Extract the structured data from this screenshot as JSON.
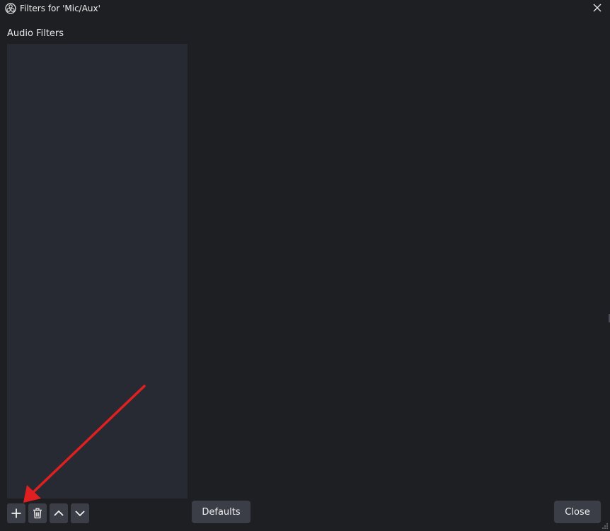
{
  "window": {
    "title": "Filters for 'Mic/Aux'",
    "app_icon": "obs-logo-icon",
    "close_icon": "close-icon"
  },
  "filters": {
    "section_label": "Audio Filters",
    "items": []
  },
  "toolbar": {
    "add_icon": "plus-icon",
    "remove_icon": "trash-icon",
    "move_up_icon": "chevron-up-icon",
    "move_down_icon": "chevron-down-icon"
  },
  "buttons": {
    "defaults_label": "Defaults",
    "close_label": "Close"
  },
  "annotation": {
    "arrow_color": "#e02020",
    "points_to": "add-filter-button"
  },
  "colors": {
    "background": "#1e1f22",
    "list_background": "#272a33",
    "button_background": "#3b3e46"
  }
}
